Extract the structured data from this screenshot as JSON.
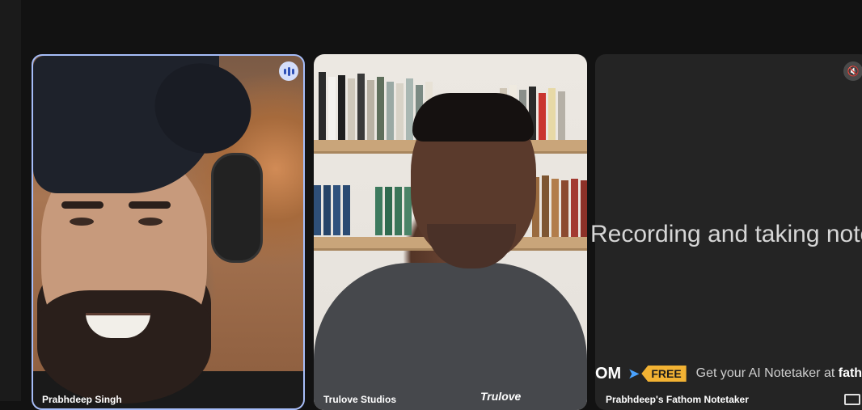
{
  "participants": [
    {
      "name": "Prabhdeep Singh",
      "state": "speaking",
      "status_icon": "speaking-icon"
    },
    {
      "name": "Trulove Studios",
      "watermark": "Trulove"
    },
    {
      "name": "Prabhdeep's Fathom Notetaker",
      "status_icon": "mic-muted-icon",
      "overlay_text": "Recording and taking notes",
      "banner": {
        "brand_fragment": "OM",
        "badge": "FREE",
        "cta_text": "Get your AI Notetaker at ",
        "cta_brand": "fath"
      }
    }
  ],
  "colors": {
    "background": "#121212",
    "active_speaker_border": "#a6bdf8",
    "free_badge": "#f2b233",
    "notetaker_tile": "#242424"
  },
  "icons": [
    "speaking-icon",
    "mic-muted-icon",
    "fathom-arrow-icon",
    "pip-icon"
  ]
}
